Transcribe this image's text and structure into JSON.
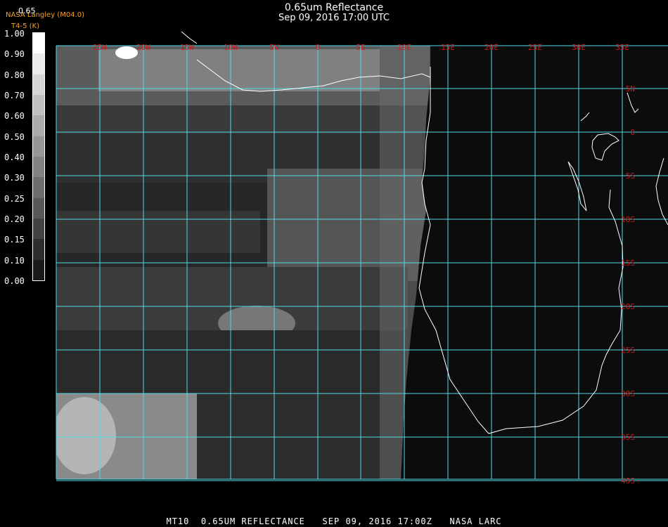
{
  "header": {
    "title": "0.65um Reflectance",
    "timestamp": "Sep 09, 2016 17:00 UTC",
    "credit": "NASA Langley (M04.0)",
    "product_code": "T4-5 (K)"
  },
  "legend": {
    "title": "0.65",
    "labels": [
      "1.00",
      "0.90",
      "0.80",
      "0.70",
      "0.60",
      "0.50",
      "0.40",
      "0.30",
      "0.25",
      "0.20",
      "0.15",
      "0.10",
      "0.00"
    ]
  },
  "map": {
    "longitude_labels": [
      "25W",
      "20W",
      "15W",
      "10W",
      "5W",
      "0",
      "5E",
      "10E",
      "15E",
      "20E",
      "25E",
      "30E",
      "35E"
    ],
    "latitude_labels": [
      "5N",
      "0",
      "5S",
      "10S",
      "15S",
      "20S",
      "25S",
      "30S",
      "35S",
      "40S"
    ],
    "grid_color": "#4fd9e8",
    "label_color": "#d01818",
    "coastline_color": "#ffffff",
    "background_color": "#0c0c0c"
  },
  "footer": {
    "text": "MT10  0.65UM REFLECTANCE   SEP 09, 2016 17:00Z   NASA LARC"
  }
}
